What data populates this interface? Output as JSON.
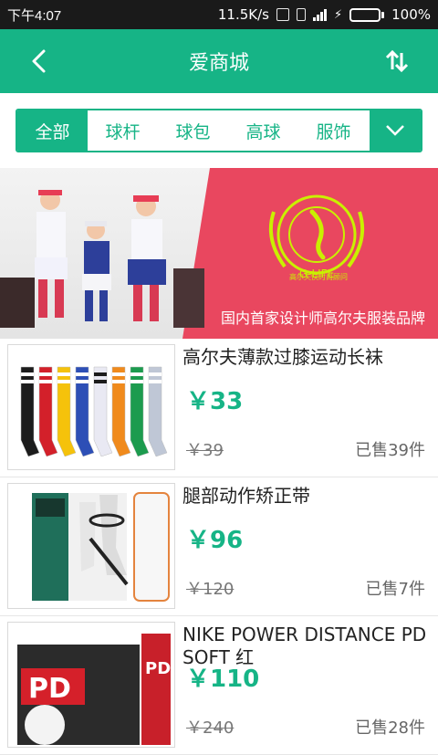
{
  "status_bar": {
    "time": "下午4:07",
    "network_speed": "11.5K/s",
    "battery_percent": "100%",
    "battery_level": 1.0
  },
  "header": {
    "title": "爱商城",
    "back_icon": "chevron-left-icon",
    "sort_icon": "sort-arrows-icon"
  },
  "tabs": [
    {
      "label": "全部",
      "active": true
    },
    {
      "label": "球杆",
      "active": false
    },
    {
      "label": "球包",
      "active": false
    },
    {
      "label": "高球",
      "active": false
    },
    {
      "label": "服饰",
      "active": false
    }
  ],
  "banner": {
    "logo_text": "G-LIFE",
    "logo_subtext": "高尔夫快时尚顾问",
    "tagline": "国内首家设计师高尔夫服装品牌"
  },
  "products": [
    {
      "name": "高尔夫薄款过膝运动长袜",
      "price": "￥33",
      "old_price": "￥39",
      "sold": "已售39件"
    },
    {
      "name": "腿部动作矫正带",
      "price": "￥96",
      "old_price": "￥120",
      "sold": "已售7件"
    },
    {
      "name": "NIKE   POWER DISTANCE PD SOFT 红",
      "price": "￥110",
      "old_price": "￥240",
      "sold": "已售28件"
    }
  ],
  "colors": {
    "accent": "#16b486",
    "banner_red": "#e9475f",
    "status_bar": "#1a1a1a"
  }
}
